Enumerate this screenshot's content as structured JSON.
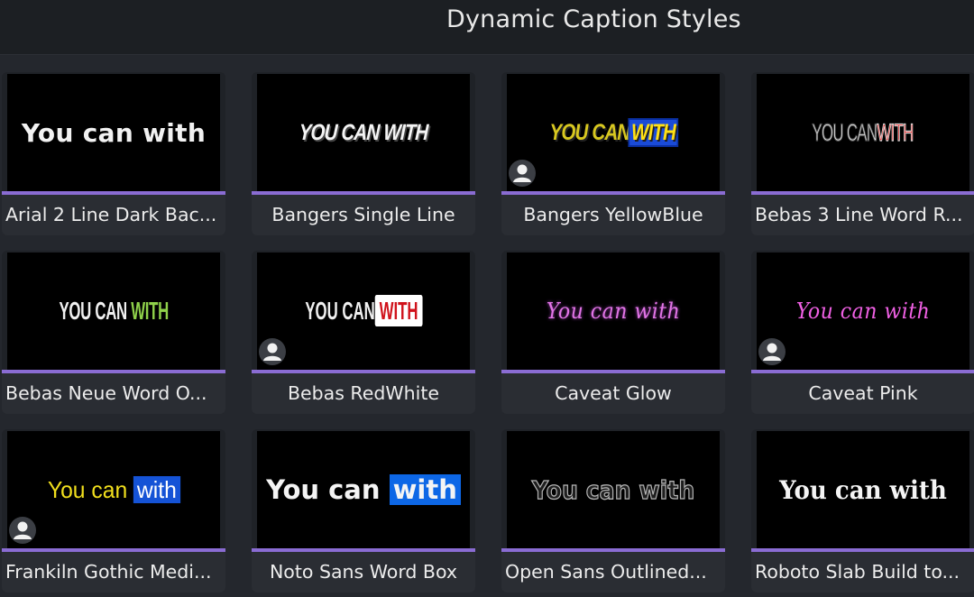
{
  "header": {
    "title": "Dynamic Caption Styles"
  },
  "colors": {
    "accent": "#8a6cd3",
    "header_bg": "#1c1f23",
    "page_bg": "#24272d"
  },
  "tiles": [
    {
      "name": "Arial 2 Line Dark Bac...",
      "preview": "You can with"
    },
    {
      "name": "Bangers Single Line",
      "preview": "YOU CAN WITH"
    },
    {
      "name": "Bangers YellowBlue",
      "preview_a": "YOU CAN",
      "preview_b": "WITH"
    },
    {
      "name": "Bebas 3 Line Word R...",
      "preview_a": "YOU CAN",
      "preview_b": "WITH"
    },
    {
      "name": "Bebas Neue Word O...",
      "preview_a": "YOU CAN",
      "preview_b": "WITH"
    },
    {
      "name": "Bebas RedWhite",
      "preview_a": "YOU CAN",
      "preview_b": "WITH"
    },
    {
      "name": "Caveat Glow",
      "preview": "You can with"
    },
    {
      "name": "Caveat Pink",
      "preview": "You can with"
    },
    {
      "name": "Frankiln Gothic Medi...",
      "preview_a": "You can",
      "preview_b": "with"
    },
    {
      "name": "Noto Sans Word Box",
      "preview_a": "You can",
      "preview_b": "with"
    },
    {
      "name": "Open Sans Outlined...",
      "preview": "You can with"
    },
    {
      "name": "Roboto Slab Build to...",
      "preview": "You can with"
    }
  ],
  "icons": {
    "avatar": "user-avatar-icon"
  }
}
